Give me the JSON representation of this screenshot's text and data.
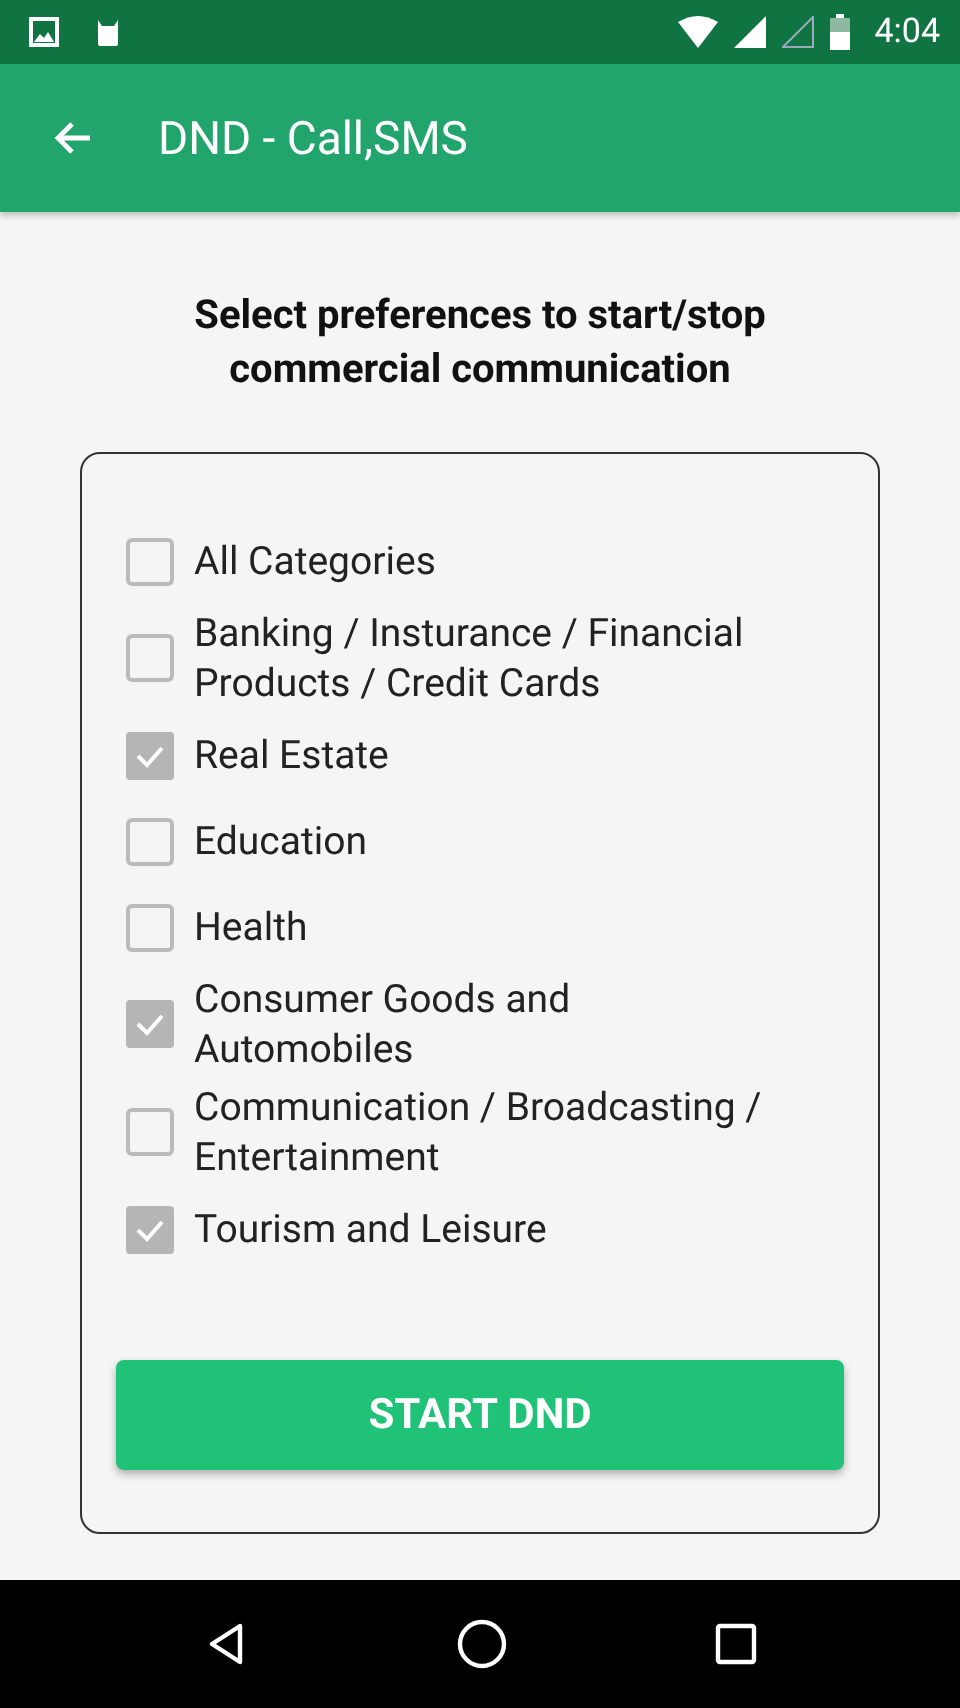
{
  "status_bar": {
    "time": "4:04"
  },
  "app_bar": {
    "title": "DND - Call,SMS"
  },
  "heading": "Select preferences to start/stop commercial communication",
  "categories": [
    {
      "label": "All Categories",
      "checked": false
    },
    {
      "label": "Banking / Insturance / Financial Products / Credit Cards",
      "checked": false
    },
    {
      "label": "Real Estate",
      "checked": true
    },
    {
      "label": "Education",
      "checked": false
    },
    {
      "label": "Health",
      "checked": false
    },
    {
      "label": "Consumer Goods and Automobiles",
      "checked": true
    },
    {
      "label": "Communication / Broadcasting / Entertainment",
      "checked": false
    },
    {
      "label": "Tourism and Leisure",
      "checked": true
    }
  ],
  "button": "START DND"
}
